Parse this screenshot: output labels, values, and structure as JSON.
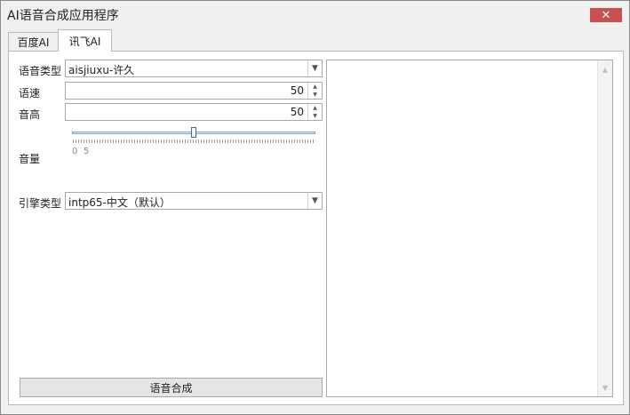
{
  "window": {
    "title": "AI语音合成应用程序",
    "close_symbol": "✕"
  },
  "tabs": [
    {
      "label": "百度AI",
      "active": false
    },
    {
      "label": "讯飞AI",
      "active": true
    }
  ],
  "form": {
    "voice_type": {
      "label": "语音类型",
      "value": "aisjiuxu-许久"
    },
    "speed": {
      "label": "语速",
      "value": "50"
    },
    "pitch": {
      "label": "音高",
      "value": "50"
    },
    "volume": {
      "label": "音量",
      "min_label": "0",
      "value_label": "5",
      "level": 0.5
    },
    "engine_type": {
      "label": "引擎类型",
      "value": "intp65-中文（默认）"
    }
  },
  "actions": {
    "synthesize_label": "语音合成"
  },
  "text_area": {
    "value": ""
  }
}
